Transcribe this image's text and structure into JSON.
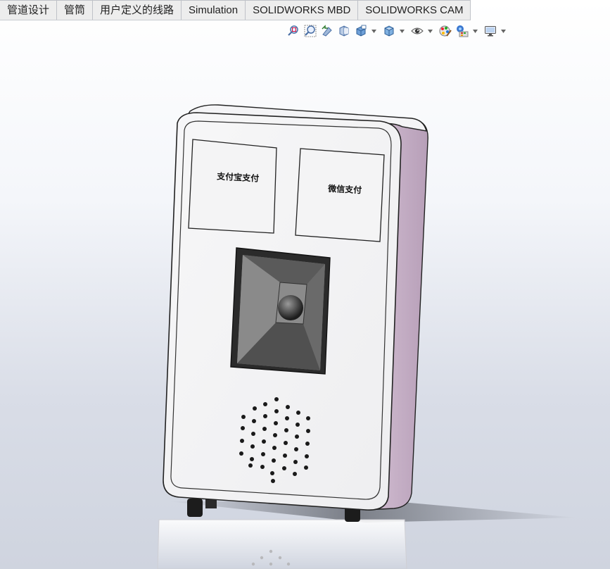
{
  "tabs": [
    {
      "label": "管道设计"
    },
    {
      "label": "管筒"
    },
    {
      "label": "用户定义的线路"
    },
    {
      "label": "Simulation"
    },
    {
      "label": "SOLIDWORKS MBD"
    },
    {
      "label": "SOLIDWORKS CAM"
    }
  ],
  "heads_up_toolbar": [
    {
      "icon": "zoom-to-fit-icon"
    },
    {
      "icon": "zoom-to-area-icon"
    },
    {
      "icon": "previous-view-icon"
    },
    {
      "icon": "section-view-icon"
    },
    {
      "icon": "view-orientation-icon",
      "dropdown": true
    },
    {
      "icon": "display-style-icon",
      "dropdown": true
    },
    {
      "icon": "hide-show-items-icon",
      "dropdown": true
    },
    {
      "icon": "edit-appearance-icon"
    },
    {
      "icon": "apply-scene-icon",
      "dropdown": true
    },
    {
      "icon": "view-settings-icon",
      "dropdown": true
    }
  ],
  "model": {
    "panel_left_text": "支付宝支付",
    "panel_right_text": "微信支付"
  }
}
